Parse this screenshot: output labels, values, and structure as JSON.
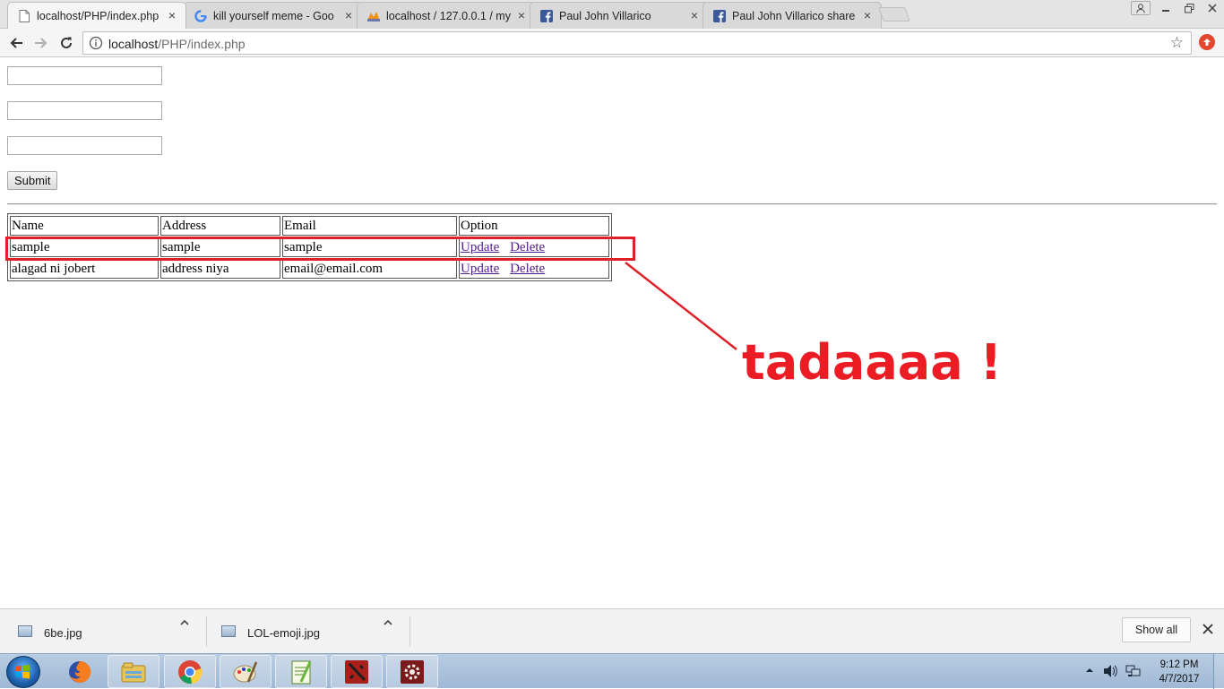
{
  "browser": {
    "tabs": [
      {
        "title": "localhost/PHP/index.php",
        "icon": "page-icon",
        "active": true
      },
      {
        "title": "kill yourself meme - Goo",
        "icon": "google-icon",
        "active": false
      },
      {
        "title": "localhost / 127.0.0.1 / my",
        "icon": "phpmyadmin-icon",
        "active": false
      },
      {
        "title": "Paul John Villarico",
        "icon": "facebook-icon",
        "active": false
      },
      {
        "title": "Paul John Villarico share",
        "icon": "facebook-icon",
        "active": false
      }
    ],
    "close_glyph": "×",
    "address": {
      "host": "localhost",
      "path": "/PHP/index.php"
    }
  },
  "form": {
    "fields": [
      {
        "name": "name",
        "value": ""
      },
      {
        "name": "address",
        "value": ""
      },
      {
        "name": "email",
        "value": ""
      }
    ],
    "submit_label": "Submit"
  },
  "table": {
    "headers": [
      "Name",
      "Address",
      "Email",
      "Option"
    ],
    "rows": [
      {
        "name": "sample",
        "address": "sample",
        "email": "sample",
        "update": "Update",
        "delete": "Delete"
      },
      {
        "name": "alagad ni jobert",
        "address": "address niya",
        "email": "email@email.com",
        "update": "Update",
        "delete": "Delete"
      }
    ]
  },
  "annotation": {
    "text": "tadaaaa !",
    "color": "#ec1c24"
  },
  "downloads": {
    "items": [
      {
        "filename": "6be.jpg"
      },
      {
        "filename": "LOL-emoji.jpg"
      }
    ],
    "show_all_label": "Show all"
  },
  "taskbar": {
    "apps": [
      "firefox-icon",
      "file-explorer-icon",
      "chrome-icon",
      "paint-icon",
      "notepad-plus-icon",
      "dota2-icon",
      "settings-gear-icon"
    ],
    "clock": {
      "time": "9:12 PM",
      "date": "4/7/2017"
    }
  }
}
